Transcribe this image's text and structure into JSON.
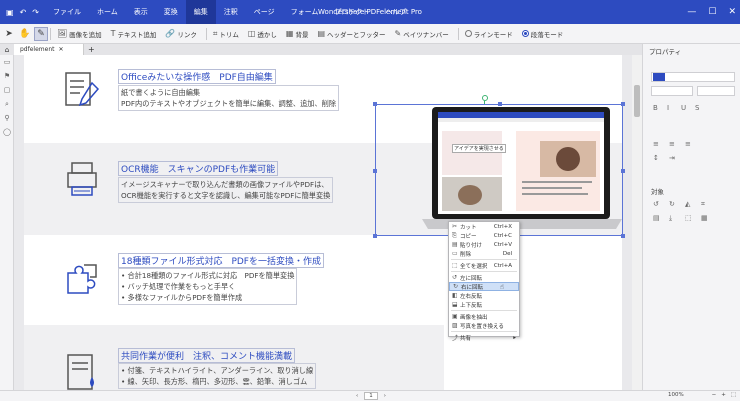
{
  "window": {
    "title": "Wondershare PDFelement Pro",
    "user": "hejia"
  },
  "menu": [
    {
      "label": "ファイル"
    },
    {
      "label": "ホーム"
    },
    {
      "label": "表示"
    },
    {
      "label": "変換"
    },
    {
      "label": "編集",
      "active": true
    },
    {
      "label": "注釈"
    },
    {
      "label": "ページ"
    },
    {
      "label": "フォーム"
    },
    {
      "label": "プロテクト"
    },
    {
      "label": "ヘルプ"
    }
  ],
  "toolbar": {
    "add_image": "画像を追加",
    "add_text": "テキスト追加",
    "link": "リンク",
    "trim": "トリム",
    "watermark": "透かし",
    "background": "背景",
    "header_footer": "ヘッダーとフッター",
    "bates": "ベイツナンバー",
    "line_mode": "ラインモード",
    "paragraph_mode": "段落モード"
  },
  "tabs": {
    "doc_tab": "pdfelement"
  },
  "features": [
    {
      "title": "Officeみたいな操作感　PDF自由編集",
      "lines": [
        "紙で書くように自由編集",
        "PDF内のテキストやオブジェクトを簡単に編集、調整、追加、削除"
      ]
    },
    {
      "title": "OCR機能　スキャンのPDFも作業可能",
      "lines": [
        "イメージスキャナーで取り込んだ書類の画像ファイルやPDFは、",
        "OCR機能を実行すると文字を認識し、編集可能なPDFに簡単変換"
      ]
    },
    {
      "title": "18種類ファイル形式対応　PDFを一括変換・作成",
      "lines": [
        "• 合計18種類のファイル形式に対応　PDFを簡単変換",
        "• バッチ処理で作業をもっと手早く",
        "• 多様なファイルからPDFを簡単作成"
      ]
    },
    {
      "title": "共同作業が便利　注釈、コメント機能満載",
      "lines": [
        "• 付箋、テキストハイライト、アンダーライン、取り消し線",
        "• 線、矢印、長方形、楕円、多辺形、雲、鉛筆、消しゴム"
      ]
    }
  ],
  "laptop_screen": {
    "caption": "アイデアを実現させる"
  },
  "context_menu": [
    {
      "label": "カット",
      "shortcut": "Ctrl+X",
      "icon": "scissors-icon"
    },
    {
      "label": "コピー",
      "shortcut": "Ctrl+C",
      "icon": "copy-icon"
    },
    {
      "label": "貼り付け",
      "shortcut": "Ctrl+V",
      "icon": "paste-icon"
    },
    {
      "label": "削除",
      "shortcut": "Del",
      "icon": "delete-icon"
    },
    {
      "label": "全てを選択",
      "shortcut": "Ctrl+A",
      "icon": "select-all-icon"
    },
    {
      "label": "左に回転",
      "shortcut": "",
      "icon": "rotate-left-icon"
    },
    {
      "label": "右に回転",
      "shortcut": "",
      "icon": "rotate-right-icon",
      "highlighted": true
    },
    {
      "label": "左右反転",
      "shortcut": "",
      "icon": "flip-horizontal-icon"
    },
    {
      "label": "上下反転",
      "shortcut": "",
      "icon": "flip-vertical-icon"
    },
    {
      "label": "画像を抽出",
      "shortcut": "",
      "icon": "extract-image-icon"
    },
    {
      "label": "写真を置き換える",
      "shortcut": "",
      "icon": "replace-image-icon"
    },
    {
      "label": "共有",
      "shortcut": "",
      "icon": "share-icon"
    }
  ],
  "properties": {
    "header": "プロパティ",
    "objects_label": "対象"
  },
  "status": {
    "page": "1",
    "zoom": "100%"
  },
  "colors": {
    "accent": "#2d4bc0",
    "selection": "#5b74d6"
  }
}
